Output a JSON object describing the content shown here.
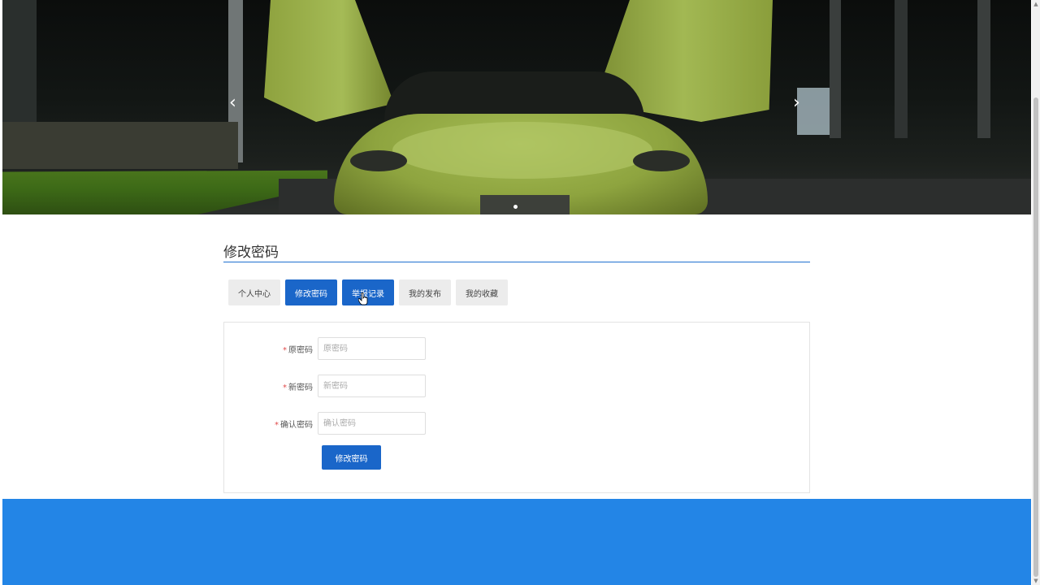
{
  "banner": {
    "prev_icon": "chevron-left-icon",
    "next_icon": "chevron-right-icon",
    "prev_glyph": "‹",
    "next_glyph": "›",
    "active_slide": 1
  },
  "page_title": "修改密码",
  "tabs": [
    {
      "label": "个人中心",
      "active": false
    },
    {
      "label": "修改密码",
      "active": true
    },
    {
      "label": "举报记录",
      "active": true
    },
    {
      "label": "我的发布",
      "active": false
    },
    {
      "label": "我的收藏",
      "active": false
    }
  ],
  "form": {
    "old_password": {
      "label": "原密码",
      "placeholder": "原密码",
      "value": ""
    },
    "new_password": {
      "label": "新密码",
      "placeholder": "新密码",
      "value": ""
    },
    "confirm_password": {
      "label": "确认密码",
      "placeholder": "确认密码",
      "value": ""
    },
    "required_mark": "*",
    "submit_label": "修改密码"
  },
  "colors": {
    "primary": "#1a66c9",
    "footer": "#2385e6",
    "required": "#e04b4b"
  }
}
